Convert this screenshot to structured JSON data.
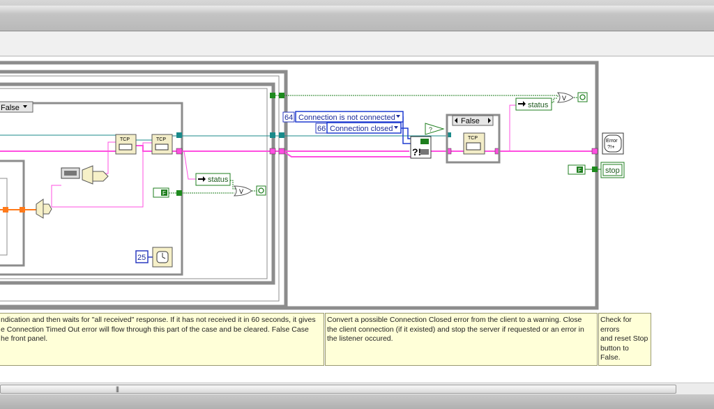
{
  "case_selectors": {
    "inner_case": "False",
    "right_case": "False"
  },
  "constants": {
    "error_code_1": "64",
    "error_code_2": "66",
    "ring_1": "Connection is not connected",
    "ring_2": "Connection closed",
    "wait_ms": "25",
    "bool_false_1": "F",
    "bool_false_2": "F"
  },
  "nodes": {
    "tcp_label": "TCP",
    "status_1": "status",
    "status_2": "status",
    "or_label": "V",
    "stop_indicator": "stop",
    "error_handler_line1": "Error",
    "error_handler_line2": "?!+"
  },
  "comments": {
    "left": "ndication and then waits for \"all received\" response.  If it has not received it in 60 seconds, it gives\ne Connection Timed Out error will flow through this part of the case and be cleared. False Case\nhe front panel.",
    "middle": "Convert a possible Connection Closed error from the client to a warning.  Close\nthe client connection (if it existed) and stop the server if requested or an error in\nthe listener occured.",
    "right": "Check for\nerrors\nand reset Stop\nbutton to\nFalse."
  },
  "scrollbar": {
    "grip": "|||"
  },
  "colors": {
    "error_wire": "#ff4fe0",
    "ref_wire": "#1a8a8a",
    "bool_wire": "#1e7e1e",
    "numeric_wire": "#ff7a1a",
    "frame_gray": "#8c8c8c",
    "comment_bg": "#ffffd8"
  }
}
